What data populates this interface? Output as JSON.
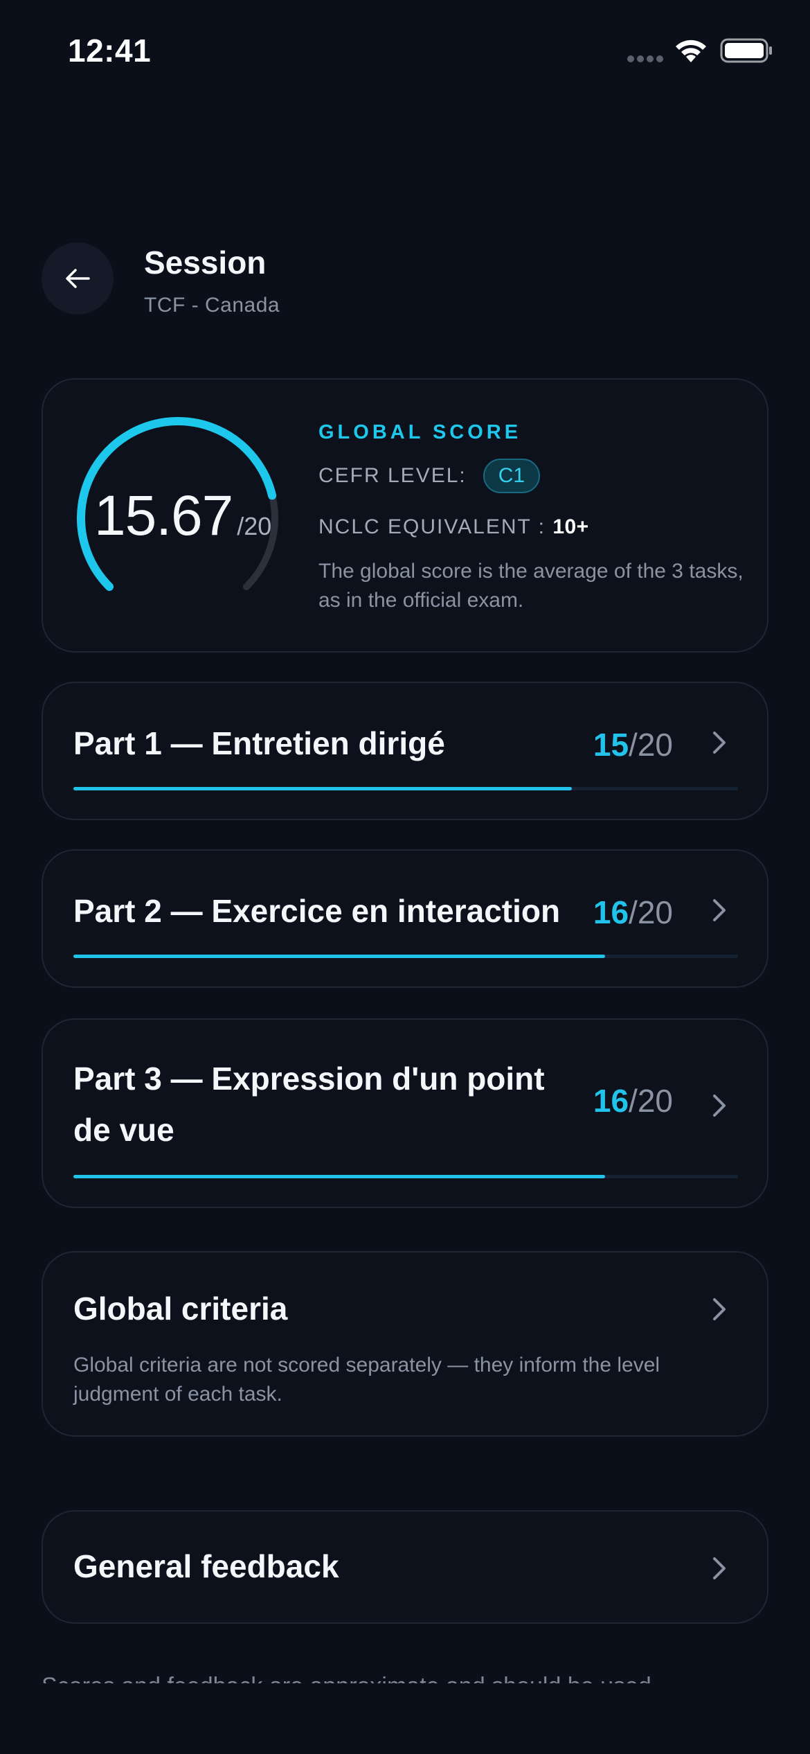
{
  "status_bar": {
    "time": "12:41"
  },
  "header": {
    "title": "Session",
    "subtitle": "TCF - Canada"
  },
  "global_score": {
    "value": "15.67",
    "max": "/20",
    "fraction": 0.7835,
    "label": "GLOBAL SCORE",
    "cefr_label": "CEFR LEVEL:",
    "cefr_value": "C1",
    "nclc_label": "NCLC EQUIVALENT :",
    "nclc_value": "10+",
    "description": "The global score is the average of the 3 tasks, as in the official exam."
  },
  "parts": [
    {
      "title": "Part 1 — Entretien dirigé",
      "score": "15",
      "max": "/20",
      "progress": 0.75
    },
    {
      "title": "Part 2 — Exercice en interaction",
      "score": "16",
      "max": "/20",
      "progress": 0.8
    },
    {
      "title": "Part 3 — Expression d'un point de vue",
      "score": "16",
      "max": "/20",
      "progress": 0.8
    }
  ],
  "criteria": {
    "title": "Global criteria",
    "description": "Global criteria are not scored separately — they inform the level judgment of each task."
  },
  "feedback": {
    "title": "General feedback"
  },
  "disclaimer": "Scores and feedback are approximate and should be used",
  "colors": {
    "accent": "#22c3ea",
    "background": "#0a0f1a",
    "card": "#0c111c"
  }
}
